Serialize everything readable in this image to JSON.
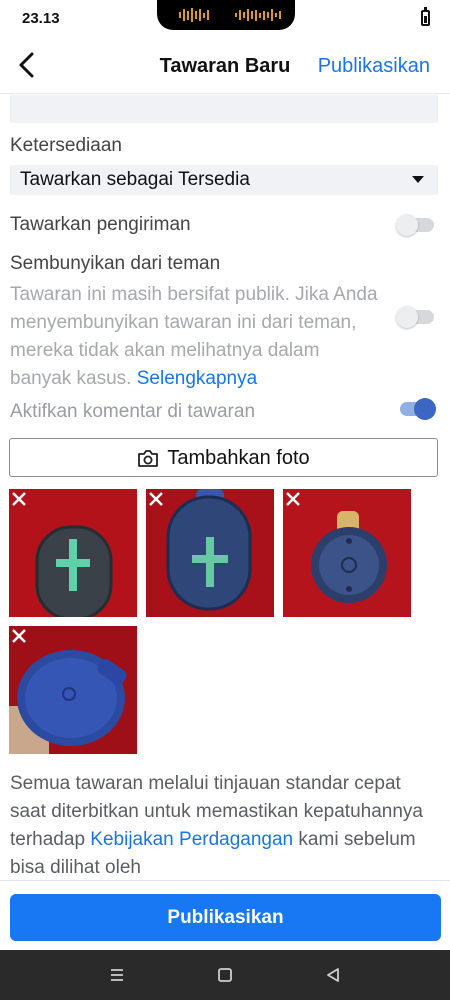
{
  "status_bar": {
    "time": "23.13",
    "battery_icon": "battery-charging-icon"
  },
  "header": {
    "back_icon": "chevron-left-icon",
    "title": "Tawaran Baru",
    "publish_label": "Publikasikan"
  },
  "availability": {
    "label": "Ketersediaan",
    "selected": "Tawarkan sebagai Tersedia",
    "caret_icon": "caret-down-icon"
  },
  "shipping": {
    "label": "Tawarkan pengiriman",
    "enabled": false
  },
  "hide_from_friends": {
    "title": "Sembunyikan dari teman",
    "description": "Tawaran ini masih bersifat publik. Jika Anda menyembunyikan tawaran ini dari teman, mereka tidak akan melihatnya dalam banyak kasus.",
    "learn_more": "Selengkapnya",
    "enabled": false
  },
  "comments": {
    "label": "Aktifkan komentar di tawaran",
    "enabled": true
  },
  "add_photo": {
    "icon": "camera-icon",
    "label": "Tambahkan foto"
  },
  "photos": [
    {
      "name": "speaker-photo-1",
      "close_icon": "close-icon"
    },
    {
      "name": "speaker-photo-2",
      "close_icon": "close-icon"
    },
    {
      "name": "speaker-photo-3",
      "close_icon": "close-icon"
    },
    {
      "name": "speaker-photo-4",
      "close_icon": "close-icon"
    }
  ],
  "review_notice": {
    "text_before": "Semua tawaran melalui tinjauan standar cepat saat diterbitkan untuk memastikan kepatuhannya terhadap",
    "link": "Kebijakan Perdagangan",
    "text_after": "kami sebelum bisa dilihat oleh"
  },
  "bottom_button": {
    "label": "Publikasikan"
  },
  "nav_bar": {
    "menu_icon": "menu-icon",
    "home_icon": "home-square-icon",
    "back_icon": "back-triangle-icon"
  },
  "colors": {
    "accent": "#1877f2",
    "link": "#1b74e4",
    "toggle_on": "#3b66c4",
    "photo_bg": "#b3121a"
  }
}
